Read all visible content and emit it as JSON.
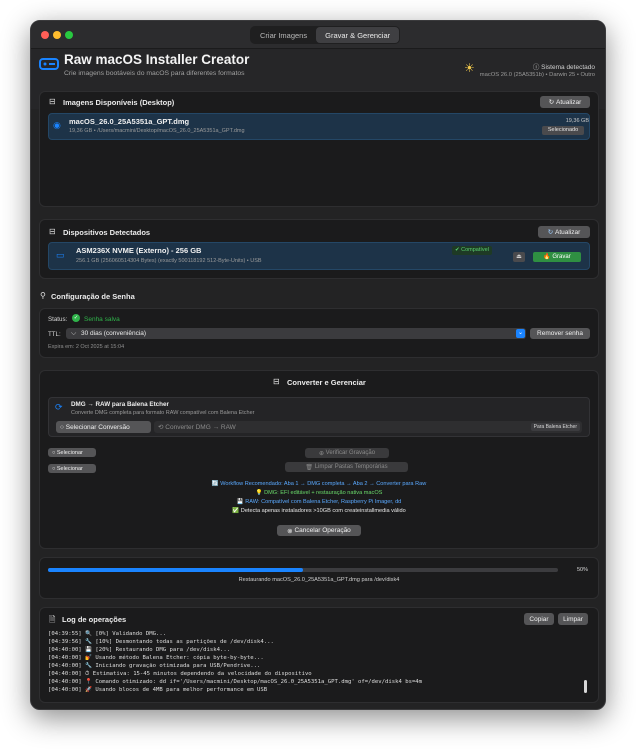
{
  "tabs": [
    "Criar Imagens",
    "Gravar & Gerenciar"
  ],
  "header": {
    "title": "Raw macOS Installer Creator",
    "subtitle": "Crie imagens bootáveis do macOS para diferentes formatos",
    "sys_title": "Sistema detectado",
    "sys_info": "macOS 26.0 (25A5351b) • Darwin 25 • Outro"
  },
  "images": {
    "title": "Imagens Disponíveis (Desktop)",
    "refresh": "Atualizar",
    "item_name": "macOS_26.0_25A5351a_GPT.dmg",
    "item_path": "19,36 GB • /Users/macmini/Desktop/macOS_26.0_25A5351a_GPT.dmg",
    "item_size": "19,36 GB",
    "item_badge": "Selecionado"
  },
  "devices": {
    "title": "Dispositivos Detectados",
    "refresh": "Atualizar",
    "item_name": "ASM236X NVME (Externo) - 256 GB",
    "item_detail": "256.1 GB (256060514304 Bytes) (exactly 500118192 512-Byte-Units)  •  USB",
    "compat": "Compatível",
    "burn": "Gravar"
  },
  "password": {
    "title": "Configuração de Senha",
    "status_label": "Status:",
    "status_value": "Senha salva",
    "ttl_label": "TTL:",
    "ttl_value": "30 dias (conveniência)",
    "remove": "Remover senha",
    "expires": "Expira em: 2 Oct 2025 at 15:04"
  },
  "convert": {
    "title": "Converter e Gerenciar",
    "mode_title": "DMG → RAW para Balena Etcher",
    "mode_desc": "Converte DMG completa para formato RAW compatível com Balena Etcher",
    "select_conv": "Selecionar Conversão",
    "convert_btn": "Converter DMG → RAW",
    "target_tag": "Para Balena Etcher",
    "select_1": "Selecionar",
    "select_2": "Selecionar",
    "verify": "Verificar Gravação",
    "clean": "Limpar Pastas Temporárias",
    "tip1": "Workflow Recomendado: Aba 1 → DMG completa → Aba 2 → Converter para Raw",
    "tip2": "DMG: EFI editável + restauração nativa macOS",
    "tip3": "RAW: Compatível com Balena Etcher, Raspberry Pi Imager, dd",
    "tip4": "Detecta apenas instaladores >10GB com createinstallmedia válido",
    "cancel": "Cancelar Operação"
  },
  "progress": {
    "percent": "50%",
    "value": 0.5,
    "caption": "Restaurando macOS_26.0_25A5351a_GPT.dmg para /dev/disk4"
  },
  "log": {
    "title": "Log de operações",
    "copy": "Copiar",
    "clear": "Limpar",
    "lines": [
      "[04:39:55] 🔍 [0%] Validando DMG...",
      "[04:39:56] 🔧 [10%] Desmontando todas as partições de /dev/disk4...",
      "[04:40:00] 💾 [20%] Restaurando DMG para /dev/disk4...",
      "[04:40:00] 💅 Usando método Balena Etcher: cópia byte-by-byte...",
      "[04:40:00] 🔧 Iniciando gravação otimizada para USB/Pendrive...",
      "[04:40:00] ⏱ Estimativa: 15-45 minutos dependendo da velocidade do dispositivo",
      "[04:40:00] 📍 Comando otimizado: dd if='/Users/macmini/Desktop/macOS_26.0_25A5351a_GPT.dmg' of=/dev/disk4 bs=4m",
      "[04:40:00] 🚀 Usando blocos de 4MB para melhor performance em USB"
    ]
  },
  "colors": {
    "accent": "#1a84ff",
    "green": "#2fb34a",
    "selected_bg": "#1d3348"
  }
}
